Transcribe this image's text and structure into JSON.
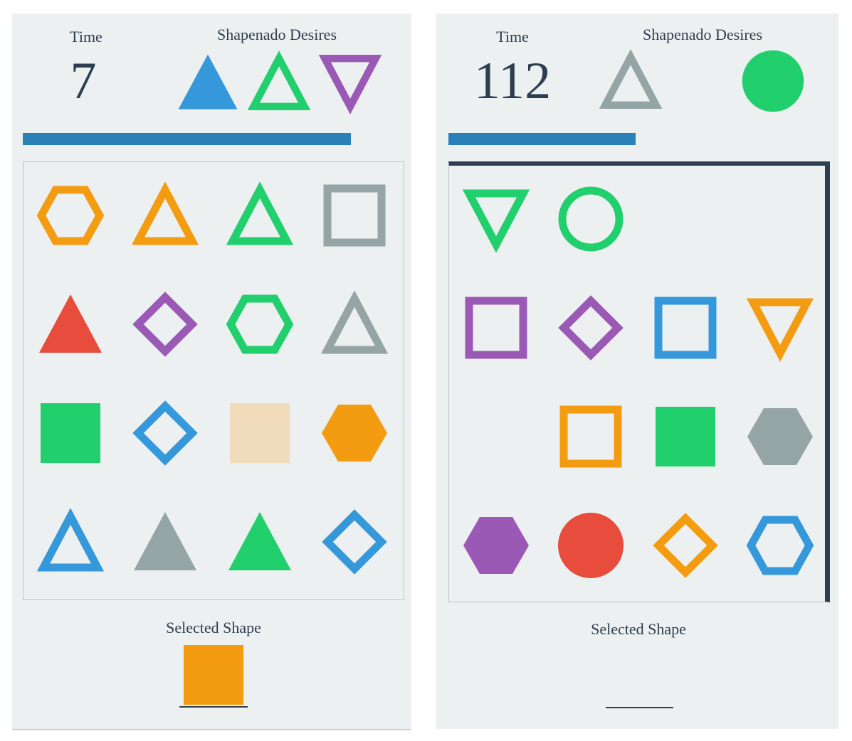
{
  "colors": {
    "orange": "#f39c12",
    "green": "#21cf6d",
    "gray": "#95a5a5",
    "red": "#e74c3c",
    "purple": "#9b59b6",
    "blue": "#3598db",
    "beige": "#f0dcba",
    "timer_bar": "#2a80b9",
    "text": "#2c3e50"
  },
  "screens": [
    {
      "time_label": "Time",
      "time_value": "7",
      "desires_label": "Shapenado Desires",
      "timer_bar_fraction": 0.86,
      "desires": [
        {
          "shape": "triangle",
          "color": "blue",
          "style": "filled"
        },
        {
          "shape": "triangle",
          "color": "green",
          "style": "outline"
        },
        {
          "shape": "triangle-down",
          "color": "purple",
          "style": "outline"
        }
      ],
      "grid": [
        [
          {
            "shape": "hexagon",
            "color": "orange",
            "style": "outline"
          },
          {
            "shape": "triangle",
            "color": "orange",
            "style": "outline"
          },
          {
            "shape": "triangle",
            "color": "green",
            "style": "outline"
          },
          {
            "shape": "square",
            "color": "gray",
            "style": "outline"
          }
        ],
        [
          {
            "shape": "triangle",
            "color": "red",
            "style": "filled"
          },
          {
            "shape": "diamond",
            "color": "purple",
            "style": "outline"
          },
          {
            "shape": "hexagon",
            "color": "green",
            "style": "outline"
          },
          {
            "shape": "triangle",
            "color": "gray",
            "style": "outline"
          }
        ],
        [
          {
            "shape": "square",
            "color": "green",
            "style": "filled"
          },
          {
            "shape": "diamond",
            "color": "blue",
            "style": "outline"
          },
          {
            "shape": "square",
            "color": "beige",
            "style": "filled"
          },
          {
            "shape": "hexagon",
            "color": "orange",
            "style": "filled"
          }
        ],
        [
          {
            "shape": "triangle",
            "color": "blue",
            "style": "outline"
          },
          {
            "shape": "triangle",
            "color": "gray",
            "style": "filled"
          },
          {
            "shape": "triangle",
            "color": "green",
            "style": "filled"
          },
          {
            "shape": "diamond",
            "color": "blue",
            "style": "outline"
          }
        ]
      ],
      "selected_label": "Selected Shape",
      "selected_shape": {
        "shape": "square",
        "color": "orange",
        "style": "filled"
      }
    },
    {
      "time_label": "Time",
      "time_value": "112",
      "desires_label": "Shapenado Desires",
      "timer_bar_fraction": 0.49,
      "desires": [
        {
          "shape": "triangle",
          "color": "gray",
          "style": "outline"
        },
        null,
        {
          "shape": "circle",
          "color": "green",
          "style": "filled"
        }
      ],
      "grid": [
        [
          {
            "shape": "triangle-down",
            "color": "green",
            "style": "outline"
          },
          {
            "shape": "circle",
            "color": "green",
            "style": "outline"
          },
          null,
          null
        ],
        [
          {
            "shape": "square",
            "color": "purple",
            "style": "outline"
          },
          {
            "shape": "diamond",
            "color": "purple",
            "style": "outline"
          },
          {
            "shape": "square",
            "color": "blue",
            "style": "outline"
          },
          {
            "shape": "triangle-down",
            "color": "orange",
            "style": "outline"
          }
        ],
        [
          null,
          {
            "shape": "square",
            "color": "orange",
            "style": "outline"
          },
          {
            "shape": "square",
            "color": "green",
            "style": "filled"
          },
          {
            "shape": "hexagon",
            "color": "gray",
            "style": "filled"
          }
        ],
        [
          {
            "shape": "hexagon",
            "color": "purple",
            "style": "filled"
          },
          {
            "shape": "circle",
            "color": "red",
            "style": "filled"
          },
          {
            "shape": "diamond",
            "color": "orange",
            "style": "outline"
          },
          {
            "shape": "hexagon",
            "color": "blue",
            "style": "outline"
          }
        ]
      ],
      "selected_label": "Selected Shape",
      "selected_shape": null
    }
  ]
}
